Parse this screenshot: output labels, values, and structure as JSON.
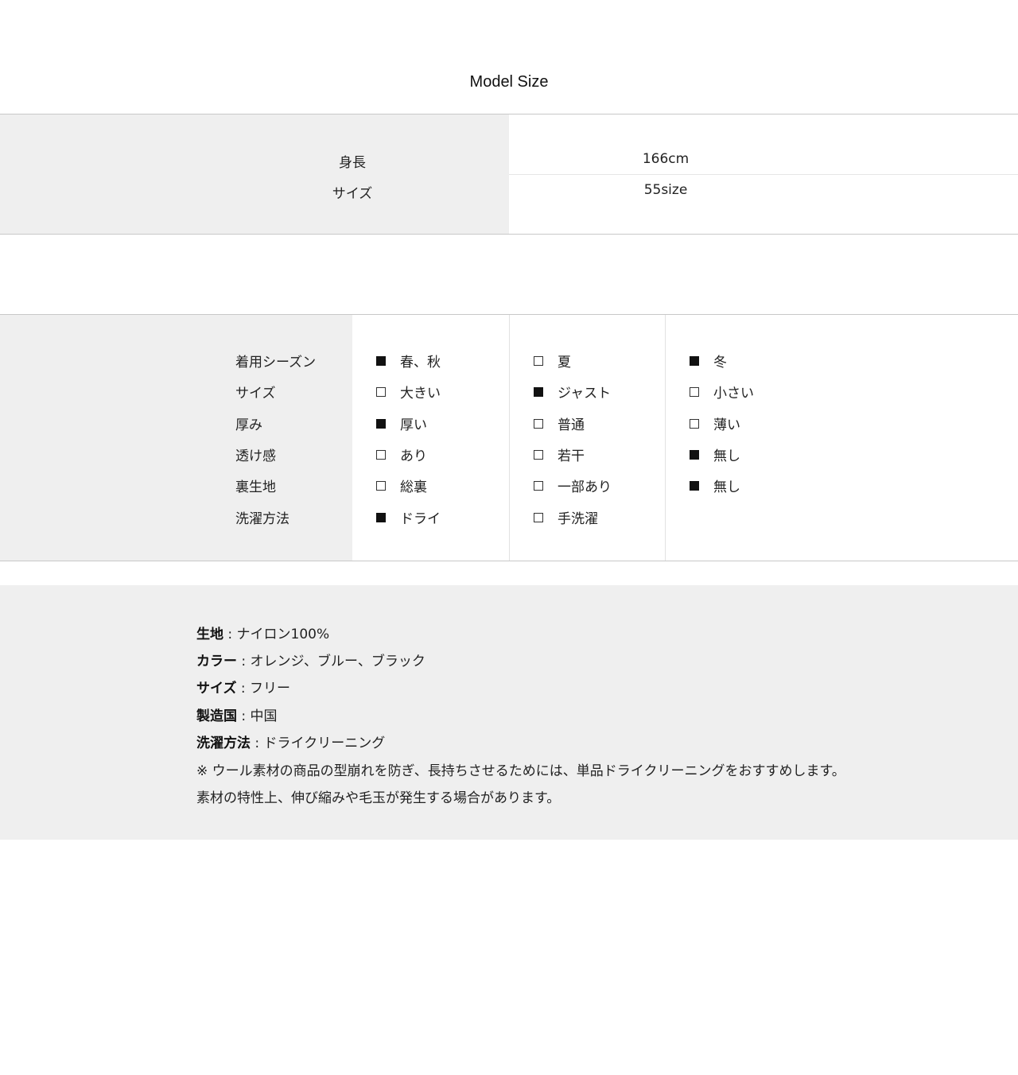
{
  "title": "Model Size",
  "model": {
    "rows": [
      {
        "label": "身長",
        "value": "166cm"
      },
      {
        "label": "サイズ",
        "value": "55size"
      }
    ]
  },
  "attributes": {
    "rows": [
      {
        "label": "着用シーズン",
        "options": [
          {
            "text": "春、秋",
            "checked": true
          },
          {
            "text": "夏",
            "checked": false
          },
          {
            "text": "冬",
            "checked": true
          }
        ]
      },
      {
        "label": "サイズ",
        "options": [
          {
            "text": "大きい",
            "checked": false
          },
          {
            "text": "ジャスト",
            "checked": true
          },
          {
            "text": "小さい",
            "checked": false
          }
        ]
      },
      {
        "label": "厚み",
        "options": [
          {
            "text": "厚い",
            "checked": true
          },
          {
            "text": "普通",
            "checked": false
          },
          {
            "text": "薄い",
            "checked": false
          }
        ]
      },
      {
        "label": "透け感",
        "options": [
          {
            "text": "あり",
            "checked": false
          },
          {
            "text": "若干",
            "checked": false
          },
          {
            "text": "無し",
            "checked": true
          }
        ]
      },
      {
        "label": "裏生地",
        "options": [
          {
            "text": "総裏",
            "checked": false
          },
          {
            "text": "一部あり",
            "checked": false
          },
          {
            "text": "無し",
            "checked": true
          }
        ]
      },
      {
        "label": "洗濯方法",
        "options": [
          {
            "text": "ドライ",
            "checked": true
          },
          {
            "text": "手洗濯",
            "checked": false
          }
        ]
      }
    ]
  },
  "info": {
    "material_key": "生地",
    "material_value": "ナイロン100%",
    "color_key": "カラー",
    "color_value": "オレンジ、ブルー、ブラック",
    "size_key": "サイズ",
    "size_value": "フリー",
    "origin_key": "製造国",
    "origin_value": "中国",
    "wash_key": "洗濯方法",
    "wash_value": "ドライクリーニング",
    "separator": " : ",
    "note1": "※ ウール素材の商品の型崩れを防ぎ、長持ちさせるためには、単品ドライクリーニングをおすすめします。",
    "note2": "素材の特性上、伸び縮みや毛玉が発生する場合があります。"
  }
}
